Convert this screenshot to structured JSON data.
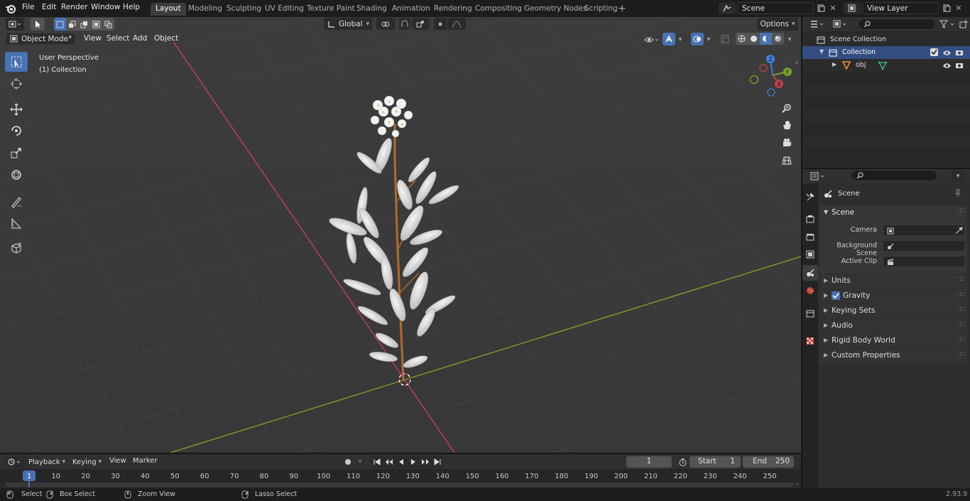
{
  "menu": {
    "file": "File",
    "edit": "Edit",
    "render": "Render",
    "window": "Window",
    "help": "Help"
  },
  "workspaces": [
    "Layout",
    "Modeling",
    "Sculpting",
    "UV Editing",
    "Texture Paint",
    "Shading",
    "Animation",
    "Rendering",
    "Compositing",
    "Geometry Nodes",
    "Scripting"
  ],
  "active_workspace": "Layout",
  "scene_name": "Scene",
  "view_layer": "View Layer",
  "viewport": {
    "mode": "Object Mode",
    "menus": [
      "View",
      "Select",
      "Add",
      "Object"
    ],
    "transform_orientation": "Global",
    "options_label": "Options",
    "perspective_label": "User Perspective",
    "collection_label": "(1) Collection",
    "gizmo_axes": {
      "x": "X",
      "y": "Y",
      "z": "Z"
    }
  },
  "outliner": {
    "scene_collection": "Scene Collection",
    "collection": "Collection",
    "object": "obj"
  },
  "properties": {
    "context": "Scene",
    "panel_title": "Scene",
    "camera_label": "Camera",
    "background_scene_label": "Background Scene",
    "active_clip_label": "Active Clip",
    "subpanels": [
      "Units",
      "Gravity",
      "Keying Sets",
      "Audio",
      "Rigid Body World",
      "Custom Properties"
    ]
  },
  "timeline": {
    "menus": [
      "Playback",
      "Keying",
      "View",
      "Marker"
    ],
    "current_frame": "1",
    "start_label": "Start",
    "start_value": "1",
    "end_label": "End",
    "end_value": "250",
    "ruler_ticks": [
      "1",
      "10",
      "20",
      "30",
      "40",
      "50",
      "60",
      "70",
      "80",
      "90",
      "100",
      "110",
      "120",
      "130",
      "140",
      "150",
      "160",
      "170",
      "180",
      "190",
      "200",
      "210",
      "220",
      "230",
      "240",
      "250"
    ]
  },
  "statusbar": {
    "select": "Select",
    "box_select": "Box Select",
    "zoom_view": "Zoom View",
    "lasso_select": "Lasso Select",
    "version": "2.93.9"
  },
  "colors": {
    "accent": "#4772b3",
    "x_axis": "#c2414e",
    "y_axis": "#7aa128",
    "z_axis": "#3d7fdd",
    "stem": "#b36a2a"
  }
}
